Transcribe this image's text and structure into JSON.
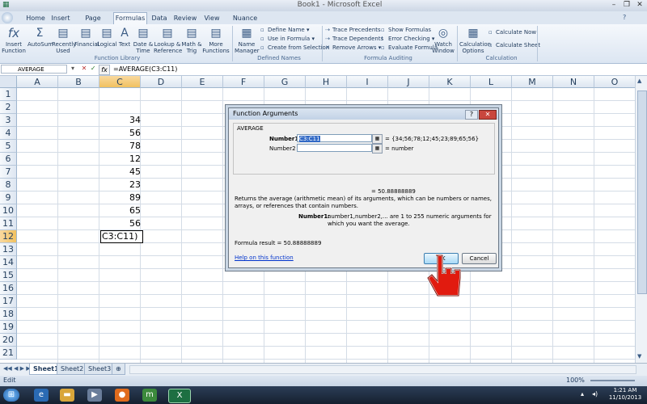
{
  "window": {
    "title": "Book1 - Microsoft Excel"
  },
  "tabs": [
    "Home",
    "Insert",
    "Page Layout",
    "Formulas",
    "Data",
    "Review",
    "View",
    "Nuance PDF"
  ],
  "active_tab": "Formulas",
  "ribbon": {
    "function_library": {
      "label": "Function Library",
      "insert_function": "Insert Function",
      "autosum": "AutoSum",
      "recently_used": "Recently Used",
      "financial": "Financial",
      "logical": "Logical",
      "text": "Text",
      "date_time": "Date & Time",
      "lookup": "Lookup & Reference",
      "math": "Math & Trig",
      "more": "More Functions"
    },
    "defined_names": {
      "label": "Defined Names",
      "name_manager": "Name Manager",
      "define_name": "Define Name",
      "use_in_formula": "Use in Formula",
      "create_from_selection": "Create from Selection"
    },
    "formula_auditing": {
      "label": "Formula Auditing",
      "trace_precedents": "Trace Precedents",
      "trace_dependents": "Trace Dependents",
      "remove_arrows": "Remove Arrows",
      "show_formulas": "Show Formulas",
      "error_checking": "Error Checking",
      "evaluate_formula": "Evaluate Formula",
      "watch_window": "Watch Window"
    },
    "calculation": {
      "label": "Calculation",
      "calculation_options": "Calculation Options",
      "calculate_now": "Calculate Now",
      "calculate_sheet": "Calculate Sheet"
    }
  },
  "formula_bar": {
    "name_box": "AVERAGE",
    "fx": "fx",
    "formula": "=AVERAGE(C3:C11)"
  },
  "columns": [
    "A",
    "B",
    "C",
    "D",
    "E",
    "F",
    "G",
    "H",
    "I",
    "J",
    "K",
    "L",
    "M",
    "N",
    "O"
  ],
  "rows": [
    "1",
    "2",
    "3",
    "4",
    "5",
    "6",
    "7",
    "8",
    "9",
    "10",
    "11",
    "12",
    "13",
    "14",
    "15",
    "16",
    "17",
    "18",
    "19",
    "20",
    "21"
  ],
  "cells": {
    "C3": "34",
    "C4": "56",
    "C5": "78",
    "C6": "12",
    "C7": "45",
    "C8": "23",
    "C9": "89",
    "C10": "65",
    "C11": "56",
    "C12": "C3:C11)"
  },
  "sheets": [
    "Sheet1",
    "Sheet2",
    "Sheet3"
  ],
  "status": {
    "mode": "Edit",
    "zoom": "100%"
  },
  "dialog": {
    "title": "Function Arguments",
    "function_name": "AVERAGE",
    "arg1_label": "Number1",
    "arg1_value": "C3:C11",
    "arg1_result": "= {34;56;78;12;45;23;89;65;56}",
    "arg2_label": "Number2",
    "arg2_result": "= number",
    "result_value": "= 50.88888889",
    "description": "Returns the average (arithmetic mean) of its arguments, which can be numbers or names, arrays, or references that contain numbers.",
    "arg_help_label": "Number1:",
    "arg_help_text": "number1,number2,... are 1 to 255 numeric arguments for which you want the average.",
    "formula_result": "Formula result =   50.88888889",
    "help_link": "Help on this function",
    "ok_label": "OK",
    "cancel_label": "Cancel"
  },
  "taskbar": {
    "time": "1:21 AM",
    "date": "11/10/2013"
  }
}
